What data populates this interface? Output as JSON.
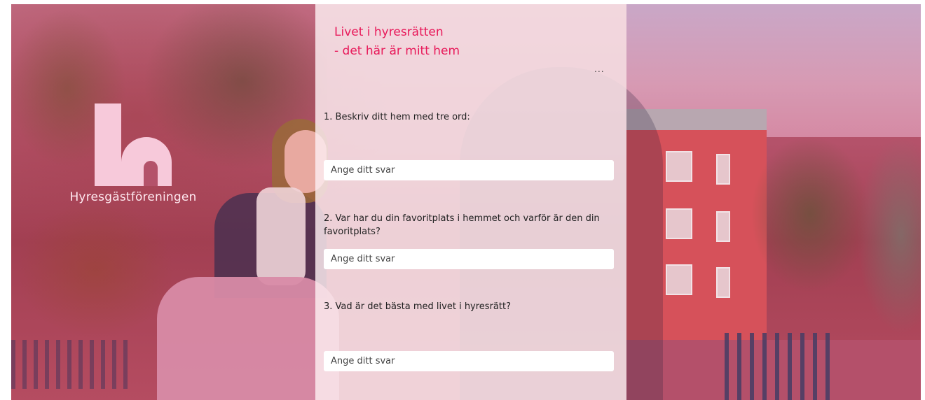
{
  "brand": {
    "name": "Hyresgästföreningen"
  },
  "form": {
    "title_line1": "Livet i hyresrätten",
    "title_line2": "- det här är mitt hem",
    "more_label": "...",
    "questions": [
      {
        "label": "1. Beskriv ditt hem med tre ord:",
        "placeholder": "Ange ditt svar",
        "value": ""
      },
      {
        "label": "2. Var har du din favoritplats i hemmet och varför är den din favoritplats?",
        "placeholder": "Ange ditt svar",
        "value": ""
      },
      {
        "label": "3. Vad är det bästa med livet i hyresrätt?",
        "placeholder": "Ange ditt svar",
        "value": ""
      }
    ]
  },
  "colors": {
    "accent": "#e8195a",
    "panel": "#fcecf0",
    "overlay": "#b4526a"
  }
}
